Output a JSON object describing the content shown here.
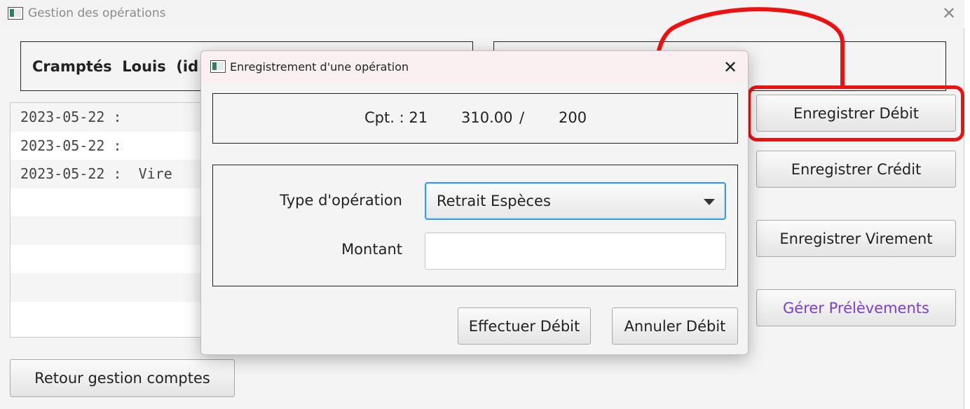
{
  "main_window": {
    "title": "Gestion des opérations",
    "client_header": "Cramptés  Louis  (id :",
    "operations": [
      "2023-05-22 :",
      "2023-05-22 :",
      "2023-05-22 :  Vire",
      "",
      "",
      "",
      "",
      ""
    ],
    "buttons": {
      "debit": "Enregistrer Débit",
      "credit": "Enregistrer Crédit",
      "virement": "Enregistrer Virement",
      "prelevements": "Gérer Prélèvements",
      "retour": "Retour gestion comptes"
    }
  },
  "dialog": {
    "title": "Enregistrement d'une opération",
    "summary": {
      "account": "Cpt. : 21",
      "balance": "310.00",
      "separator": "/",
      "overdraft": "200"
    },
    "form": {
      "type_label": "Type d'opération",
      "type_value": "Retrait Espèces",
      "amount_label": "Montant",
      "amount_value": ""
    },
    "buttons": {
      "submit": "Effectuer Débit",
      "cancel": "Annuler Débit"
    }
  },
  "icons": {
    "app": "app-window-icon",
    "close": "close-icon",
    "dropdown": "chevron-down-icon"
  },
  "colors": {
    "annotation": "#ee1111",
    "focus_border": "#3b9bd6",
    "link_purple": "#7a3fd1",
    "dialog_title_bg": "#fbf0f1"
  }
}
